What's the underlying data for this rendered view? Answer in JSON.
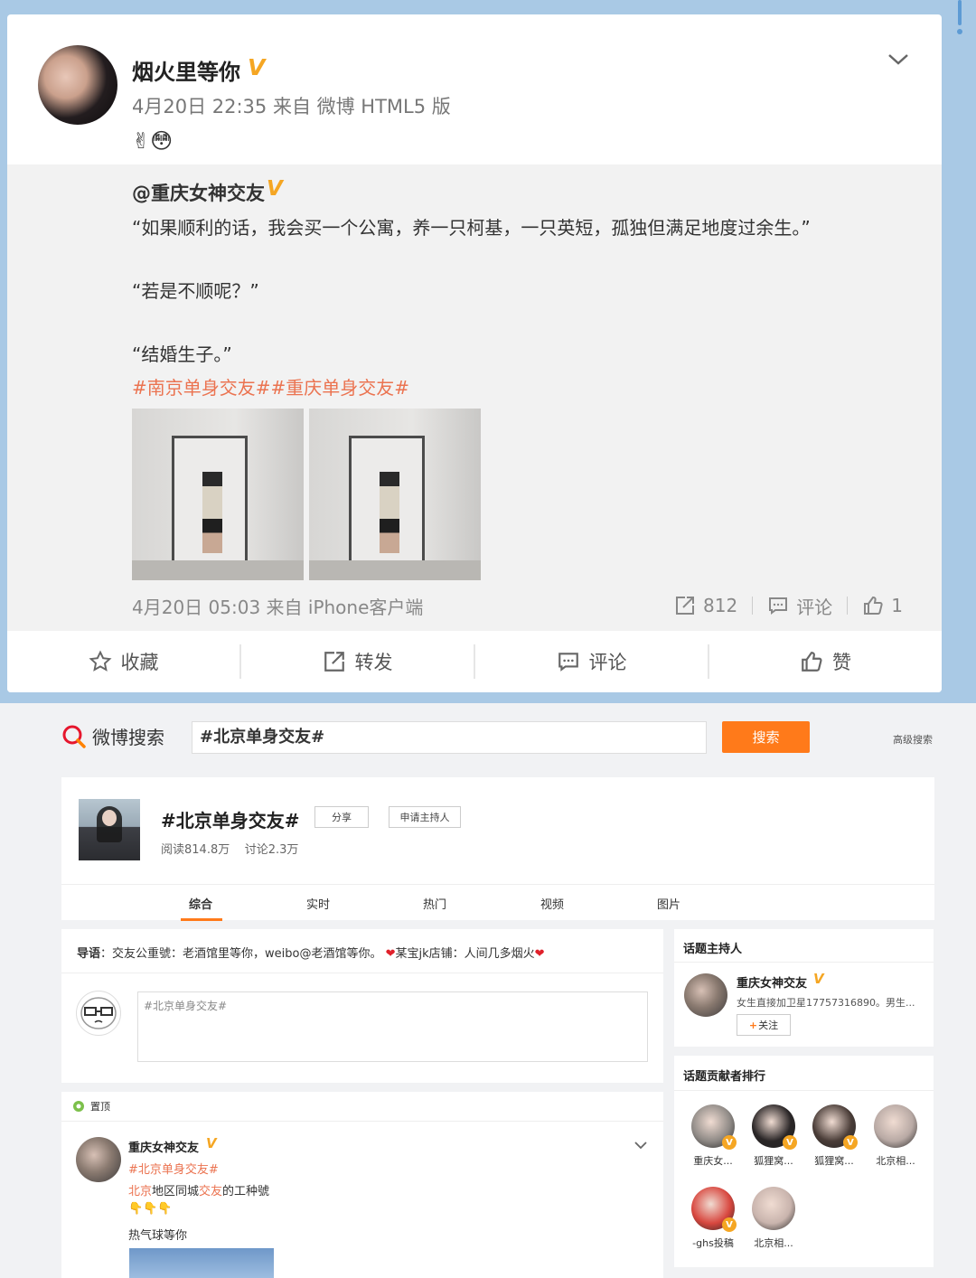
{
  "top": {
    "user": "烟火里等你",
    "meta": "4月20日 22:35 来自 微博 HTML5 版",
    "emoji": "✌😳",
    "repost": {
      "user": "@重庆女神交友",
      "line1": "“如果顺利的话，我会买一个公寓，养一只柯基，一只英短，孤独但满足地度过余生。”",
      "line2": "“若是不顺呢？”",
      "line3": "“结婚生子。”",
      "tags": "#南京单身交友##重庆单身交友#",
      "time": "4月20日 05:03 来自 iPhone客户端",
      "reposts": "812",
      "comments_label": "评论",
      "likes": "1"
    },
    "actions": {
      "favorite": "收藏",
      "forward": "转发",
      "comment": "评论",
      "like": "赞"
    }
  },
  "bottom": {
    "logo": "微博搜索",
    "search_value": "#北京单身交友#",
    "search_button": "搜索",
    "advanced": "高级搜索",
    "topic": {
      "title": "#北京单身交友#",
      "share": "分享",
      "apply_host": "申请主持人",
      "reads": "阅读814.8万",
      "discussions": "讨论2.3万"
    },
    "tabs": [
      "综合",
      "实时",
      "热门",
      "视频",
      "图片"
    ],
    "guide": {
      "label": "导语",
      "text1": "：交友公重號：老酒馆里等你，weibo@老酒馆等你。",
      "text2": "某宝jk店铺：人间几多烟火"
    },
    "compose_placeholder": "#北京单身交友#",
    "pinned": "置顶",
    "post": {
      "user": "重庆女神交友",
      "tag": "#北京单身交友#",
      "line_part1": "北京",
      "line_part2": "地区同城",
      "line_part3": "交友",
      "line_part4": "的工种號",
      "emoji": "👇👇👇",
      "line2": "热气球等你"
    },
    "host_panel": {
      "title": "话题主持人",
      "name": "重庆女神交友",
      "desc": "女生直接加卫星17757316890。男生...",
      "follow": "关注"
    },
    "rank_panel": {
      "title": "话题贡献者排行",
      "users": [
        {
          "name": "重庆女...",
          "color": "#8f8a86",
          "verified": true
        },
        {
          "name": "狐狸窝...",
          "color": "#2a2627",
          "verified": true
        },
        {
          "name": "狐狸窝...",
          "color": "#4a3d38",
          "verified": true
        },
        {
          "name": "北京相...",
          "color": "#b8a9a4",
          "verified": false
        },
        {
          "name": "-ghs投稿",
          "color": "#d8473f",
          "verified": true
        },
        {
          "name": "北京相...",
          "color": "#c9b4ad",
          "verified": false
        }
      ]
    }
  },
  "colors": {
    "accent": "#ff7a1a",
    "link": "#eb7350",
    "verified": "#f5a623",
    "top_bg": "#a9c9e5"
  }
}
